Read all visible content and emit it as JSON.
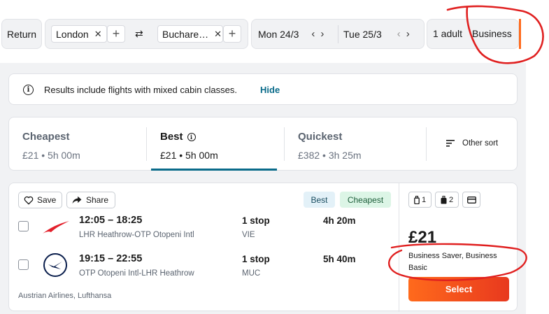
{
  "search": {
    "trip_type": "Return",
    "origin": "London",
    "destination": "Buchare…",
    "depart_date": "Mon 24/3",
    "return_date": "Tue 25/3",
    "travelers": "1 adult",
    "cabin": "Business"
  },
  "notice": {
    "text": "Results include flights with mixed cabin classes.",
    "action": "Hide"
  },
  "sort_tabs": [
    {
      "label": "Cheapest",
      "sub": "£21 • 5h 00m"
    },
    {
      "label": "Best",
      "sub": "£21 • 5h 00m"
    },
    {
      "label": "Quickest",
      "sub": "£382 • 3h 25m"
    }
  ],
  "other_sort": "Other sort",
  "result": {
    "save_label": "Save",
    "share_label": "Share",
    "tags": [
      "Best",
      "Cheapest"
    ],
    "legs": [
      {
        "times": "12:05 – 18:25",
        "route": "LHR Heathrow-OTP Otopeni Intl",
        "stops": "1 stop",
        "via": "VIE",
        "duration": "4h 20m"
      },
      {
        "times": "19:15 – 22:55",
        "route": "OTP Otopeni Intl-LHR Heathrow",
        "stops": "1 stop",
        "via": "MUC",
        "duration": "5h 40m"
      }
    ],
    "airlines": "Austrian Airlines, Lufthansa",
    "bags": {
      "personal": "1",
      "carry_on": "2"
    },
    "price": "£21",
    "fare": "Business Saver, Business Basic",
    "select_label": "Select"
  },
  "colors": {
    "select_gradient_start": "#ff6a1c",
    "select_gradient_end": "#e8391e",
    "tab_underline": "#0a6b8a",
    "annotation": "#e02020",
    "tag_best_bg": "#e3f1f8",
    "tag_cheapest_bg": "#dcf5e6"
  }
}
